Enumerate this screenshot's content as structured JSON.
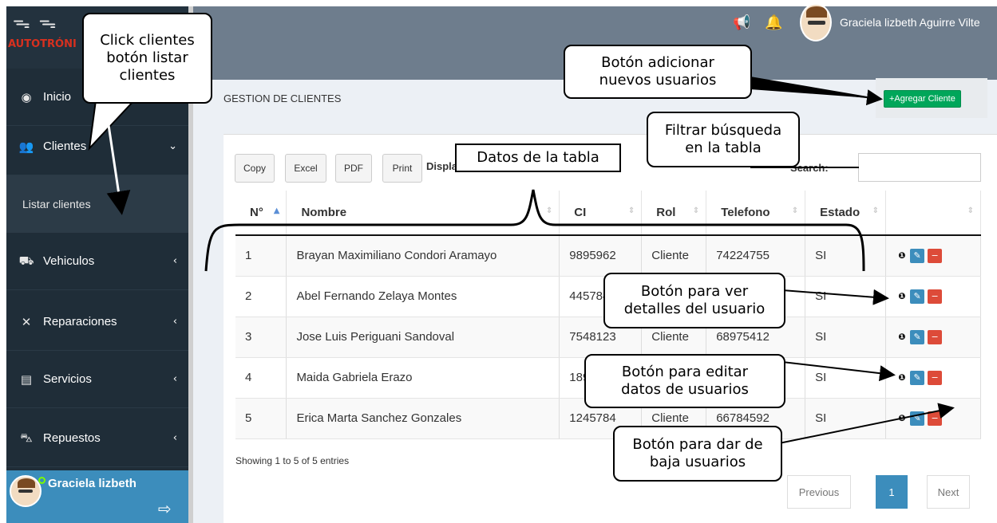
{
  "logo": {
    "text": "AUTOTRÓNI",
    "icons": "ᯓ ᯓ"
  },
  "sidebar": {
    "items": [
      {
        "label": "Inicio",
        "icon": "dashboard-icon",
        "glyph": "◉",
        "arrow": ""
      },
      {
        "label": "Clientes",
        "icon": "users-icon",
        "glyph": "👥",
        "arrow": "⌄"
      },
      {
        "label": "Vehiculos",
        "icon": "car-icon",
        "glyph": "⛟",
        "arrow": "‹"
      },
      {
        "label": "Reparaciones",
        "icon": "wrench-icon",
        "glyph": "✕",
        "arrow": "‹"
      },
      {
        "label": "Servicios",
        "icon": "clipboard-icon",
        "glyph": "▤",
        "arrow": "‹"
      },
      {
        "label": "Repuestos",
        "icon": "cart-icon",
        "glyph": "⛍",
        "arrow": "‹"
      }
    ],
    "submenu_label": "Listar clientes",
    "user_name": "Graciela lizbeth"
  },
  "header": {
    "user_name": "Graciela lizbeth Aguirre Vilte"
  },
  "main": {
    "section_title": "GESTION DE CLIENTES",
    "add_button": "+Agregar Cliente",
    "buttons": [
      "Copy",
      "Excel",
      "PDF",
      "Print"
    ],
    "display_label": "Displa",
    "search_label": "Search:",
    "search_value": "",
    "columns": [
      "N°",
      "Nombre",
      "CI",
      "Rol",
      "Telefono",
      "Estado",
      ""
    ],
    "rows": [
      [
        "1",
        "Brayan Maximiliano Condori Aramayo",
        "9895962",
        "Cliente",
        "74224755",
        "SI"
      ],
      [
        "2",
        "Abel Fernando Zelaya Montes",
        "445784",
        "",
        "",
        "SI"
      ],
      [
        "3",
        "Jose Luis Periguani Sandoval",
        "7548123",
        "Cliente",
        "68975412",
        "SI"
      ],
      [
        "4",
        "Maida Gabriela Erazo",
        "189",
        "",
        "",
        "SI"
      ],
      [
        "5",
        "Erica Marta Sanchez Gonzales",
        "1245784",
        "Cliente",
        "66784592",
        "SI"
      ]
    ],
    "showing": "Showing 1 to 5 of 5 entries",
    "pagination": {
      "previous": "Previous",
      "current": "1",
      "next": "Next"
    }
  },
  "callouts": {
    "clientes": [
      "Click clientes",
      "botón listar",
      "clientes"
    ],
    "adicionar": [
      "Botón adicionar",
      "nuevos usuarios"
    ],
    "filtrar": [
      "Filtrar búsqueda",
      "en la tabla"
    ],
    "datos": [
      "Datos de la tabla"
    ],
    "ver": [
      "Botón para ver",
      "detalles del usuario"
    ],
    "editar": [
      "Botón para editar",
      "datos de usuarios"
    ],
    "baja": [
      "Botón para dar de",
      "baja usuarios"
    ]
  },
  "colors": {
    "sidebar": "#1f2d38",
    "header": "#6e7d8d",
    "accent": "#3c8dbc",
    "add": "#00a65a",
    "delete": "#dd4b39"
  }
}
